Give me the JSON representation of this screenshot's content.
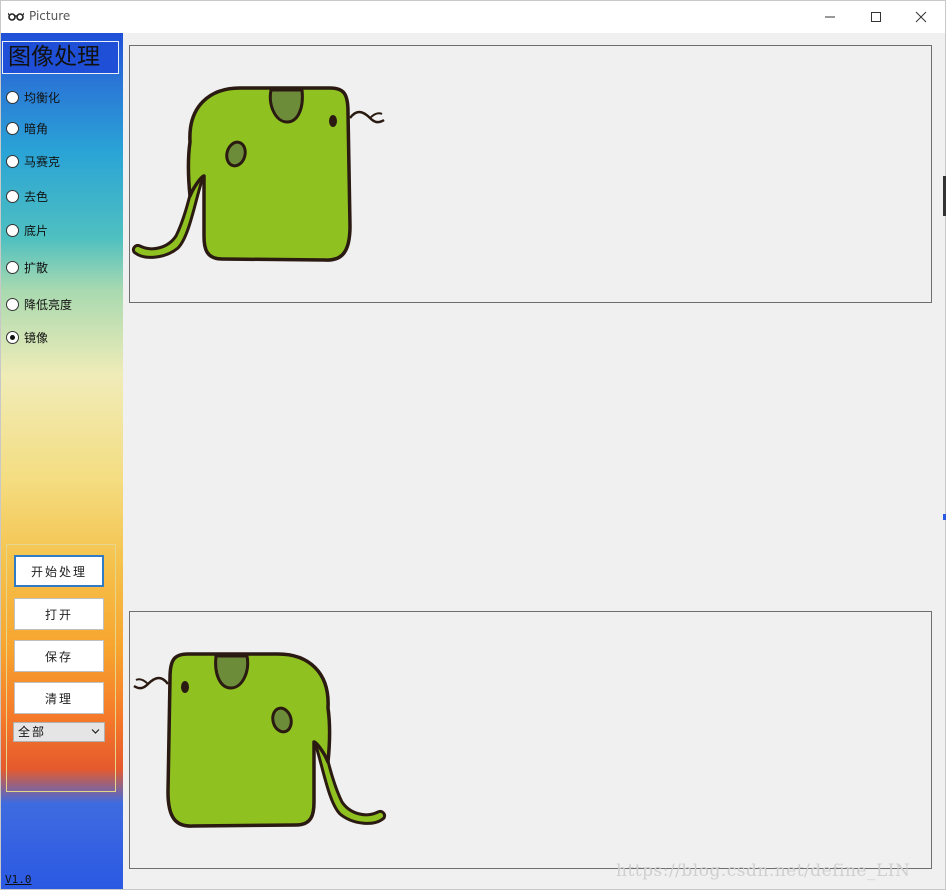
{
  "window": {
    "title": "Picture",
    "icon": "glasses-icon"
  },
  "sidebar": {
    "title": "图像处理",
    "effects": [
      {
        "label": "均衡化",
        "checked": false
      },
      {
        "label": "暗角",
        "checked": false
      },
      {
        "label": "马赛克",
        "checked": false
      },
      {
        "label": "去色",
        "checked": false
      },
      {
        "label": "底片",
        "checked": false
      },
      {
        "label": "扩散",
        "checked": false
      },
      {
        "label": "降低亮度",
        "checked": false
      },
      {
        "label": "镜像",
        "checked": true
      }
    ],
    "buttons": {
      "start": "开始处理",
      "open": "打开",
      "save": "保存",
      "clear": "清理"
    },
    "scope_select": {
      "value": "全部"
    },
    "version": "V1.0"
  },
  "panels": {
    "source": {
      "image": "elephant-icon"
    },
    "result": {
      "image": "elephant-mirrored-icon"
    }
  },
  "watermark": "https://blog.csdn.net/define_LIN",
  "colors": {
    "elephant_body": "#8fc120",
    "elephant_spot": "#6d8c3a",
    "outline": "#2a1a12",
    "primary_button_border": "#2f7bc5"
  }
}
